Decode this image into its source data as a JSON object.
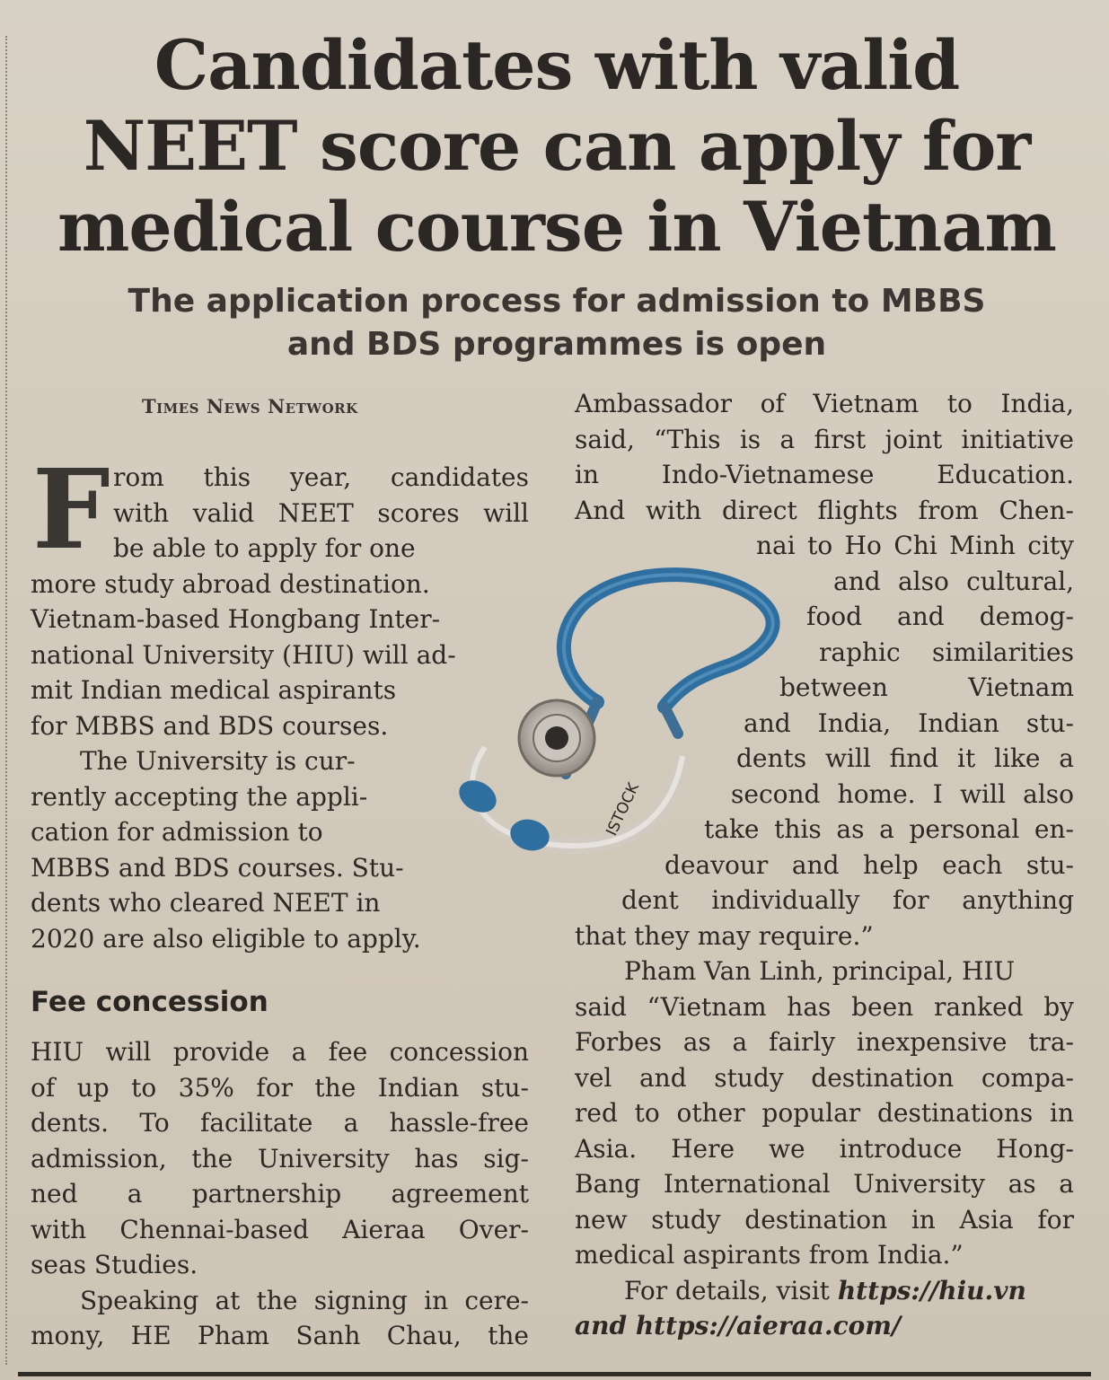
{
  "article": {
    "headline": [
      "Candidates with valid",
      "NEET score can apply for",
      "medical course in Vietnam"
    ],
    "deck": [
      "The application process for admission to MBBS",
      "and BDS programmes is open"
    ],
    "byline": "Times News Network",
    "drop_cap": "F",
    "left_column": {
      "p1": [
        "rom this year, candidates",
        "with valid NEET scores will",
        "be able to apply for one",
        "more study abroad destination.",
        "Vietnam-based Hongbang Inter-",
        "national University (HIU) will ad-",
        "mit Indian medical aspirants",
        "for MBBS and BDS courses."
      ],
      "p2": [
        "The University is cur-",
        "rently accepting the appli-",
        "cation for admission to",
        "MBBS and BDS courses. Stu-",
        "dents who cleared NEET in",
        "2020 are also eligible to apply."
      ],
      "subhead": "Fee concession",
      "p3": [
        "HIU will provide a fee concession",
        "of up to 35% for the Indian stu-",
        "dents. To facilitate a hassle-free",
        "admission, the University has sig-",
        "ned a partnership agreement",
        "with Chennai-based Aieraa Over-",
        "seas Studies."
      ],
      "p4": [
        "Speaking at the signing in cere-",
        "mony, HE Pham Sanh Chau, the"
      ]
    },
    "right_column": {
      "p1": [
        "Ambassador of Vietnam to India,",
        "said, “This is a first joint initiative",
        "in Indo-Vietnamese Education.",
        "And with direct flights from Chen-",
        "nai to Ho Chi Minh city",
        "and also cultural,",
        "food and demog-",
        "raphic similarities",
        "between Vietnam",
        "and India, Indian stu-",
        "dents will find it like a",
        "second home. I will also",
        "take this as a personal en-",
        "deavour and help each stu-",
        "dent individually for anything",
        "that they may require.”"
      ],
      "p2": [
        "Pham Van Linh, principal, HIU",
        "said “Vietnam has been ranked by",
        "Forbes as a fairly inexpensive tra-",
        "vel and study destination compa-",
        "red to other popular destinations in",
        "Asia. Here we introduce Hong-",
        "Bang International University as a",
        "new study destination in Asia for",
        "medical aspirants from India.”"
      ],
      "p3_prefix": "For details, visit",
      "url1": "https://hiu.vn",
      "p3_and": "and",
      "url2": "https://aieraa.com/"
    },
    "photo_credit": "ISTOCK"
  },
  "colors": {
    "paper": "#d4ccbe",
    "ink": "#2a2622",
    "stethoscope_tube": "#2f6f9f"
  }
}
